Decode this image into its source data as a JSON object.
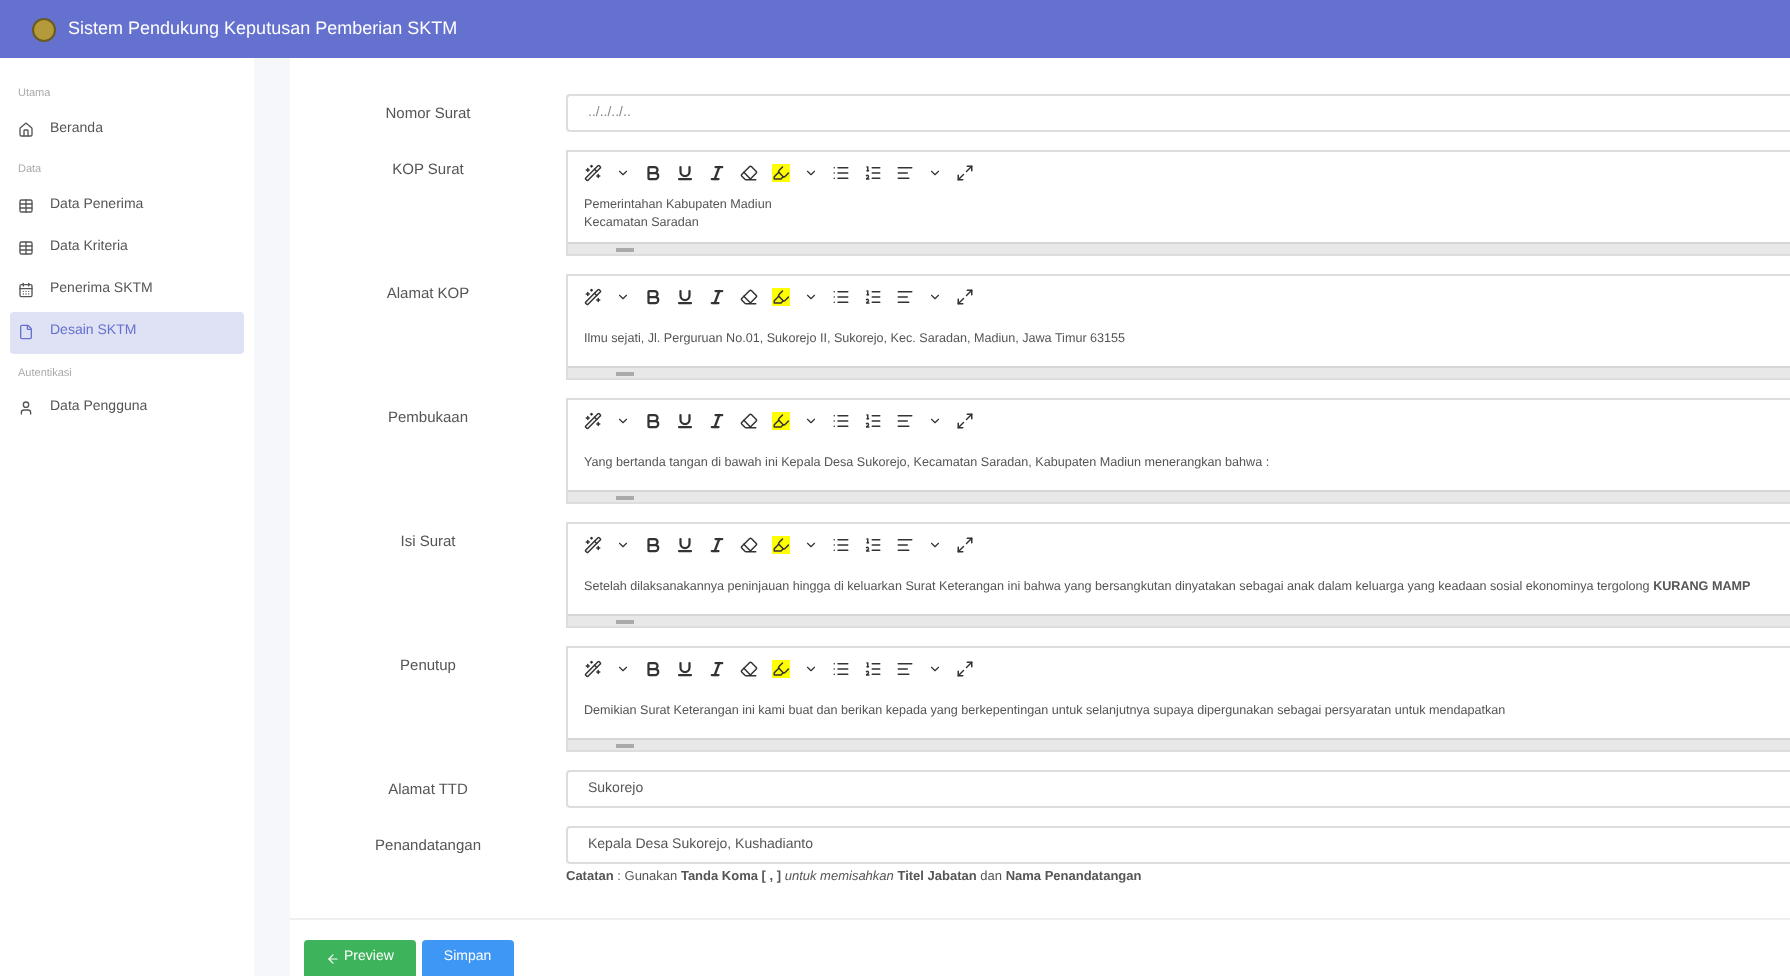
{
  "header": {
    "title": "Sistem Pendukung Keputusan Pemberian SKTM"
  },
  "sidebar": {
    "sections": [
      {
        "heading": "Utama",
        "items": [
          {
            "label": "Beranda",
            "selected": false
          }
        ]
      },
      {
        "heading": "Data",
        "items": [
          {
            "label": "Data Penerima",
            "selected": false
          },
          {
            "label": "Data Kriteria",
            "selected": false
          },
          {
            "label": "Penerima SKTM",
            "selected": false
          },
          {
            "label": "Desain SKTM",
            "selected": true
          }
        ]
      },
      {
        "heading": "Autentikasi",
        "items": [
          {
            "label": "Data Pengguna",
            "selected": false
          }
        ]
      }
    ]
  },
  "form": {
    "fields": [
      {
        "kind": "input",
        "label": "Nomor Surat",
        "placeholder": "../../../.."
      },
      {
        "kind": "editor",
        "label": "KOP Surat",
        "lines": [
          "Pemerintahan Kabupaten Madiun",
          "Kecamatan Saradan"
        ]
      },
      {
        "kind": "editor",
        "label": "Alamat KOP",
        "lines": [
          "Ilmu sejati, Jl. Perguruan No.01, Sukorejo II, Sukorejo, Kec. Saradan, Madiun, Jawa Timur 63155"
        ]
      },
      {
        "kind": "editor",
        "label": "Pembukaan",
        "lines": [
          "Yang bertanda tangan di bawah ini Kepala Desa Sukorejo, Kecamatan Saradan, Kabupaten Madiun menerangkan bahwa :"
        ]
      },
      {
        "kind": "editor",
        "label": "Isi Surat",
        "lines": [
          "Setelah dilaksanakannya peninjauan hingga di keluarkan Surat Keterangan ini bahwa yang bersangkutan dinyatakan sebagai anak dalam keluarga yang keadaan sosial ekonominya tergolong **KURANG MAMP**"
        ]
      },
      {
        "kind": "editor",
        "label": "Penutup",
        "lines": [
          "Demikian Surat Keterangan ini kami buat dan berikan kepada yang berkepentingan untuk selanjutnya supaya dipergunakan sebagai persyaratan untuk mendapatkan"
        ]
      },
      {
        "kind": "input",
        "label": "Alamat TTD",
        "value": "Sukorejo"
      },
      {
        "kind": "input",
        "label": "Penandatangan",
        "value": "Kepala Desa Sukorejo, Kushadianto",
        "note": "**Catatan** : Gunakan **Tanda Koma [ , ]** *untuk memisahkan* **Titel Jabatan** dan **Nama Penandatangan**"
      }
    ]
  },
  "buttons": [
    {
      "label": "Preview",
      "kind": "back"
    },
    {
      "label": "Simpan",
      "kind": "save"
    }
  ]
}
